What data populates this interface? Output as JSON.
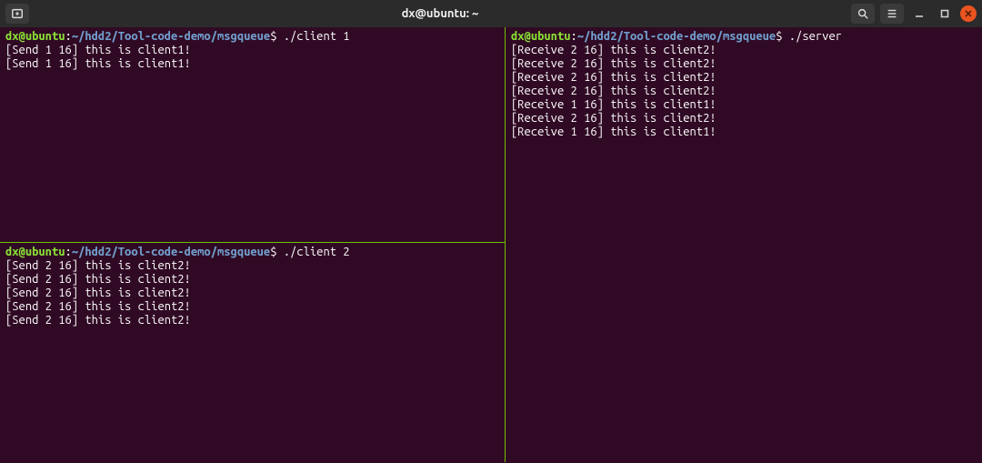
{
  "window": {
    "title": "dx@ubuntu: ~"
  },
  "icons": {
    "new_tab": "new-tab",
    "search": "search",
    "menu": "menu",
    "minimize": "minimize",
    "maximize": "maximize",
    "close": "close"
  },
  "colors": {
    "terminal_bg": "#300a24",
    "split_border": "#6fbf00",
    "titlebar_bg": "#2b2b2b",
    "prompt_user": "#8ae234",
    "prompt_path": "#729fcf",
    "close_button": "#e95420"
  },
  "prompt": {
    "user_host": "dx@ubuntu",
    "colon": ":",
    "path": "~/hdd2/Tool-code-demo/msgqueue",
    "dollar": "$"
  },
  "panes": {
    "top_left": {
      "command": "./client 1",
      "output": [
        "[Send 1 16] this is client1!",
        "[Send 1 16] this is client1!"
      ]
    },
    "bottom_left": {
      "command": "./client 2",
      "output": [
        "[Send 2 16] this is client2!",
        "[Send 2 16] this is client2!",
        "[Send 2 16] this is client2!",
        "[Send 2 16] this is client2!",
        "[Send 2 16] this is client2!"
      ]
    },
    "right": {
      "command": "./server",
      "output": [
        "[Receive 2 16] this is client2!",
        "[Receive 2 16] this is client2!",
        "[Receive 2 16] this is client2!",
        "[Receive 2 16] this is client2!",
        "[Receive 1 16] this is client1!",
        "[Receive 2 16] this is client2!",
        "[Receive 1 16] this is client1!"
      ]
    }
  }
}
